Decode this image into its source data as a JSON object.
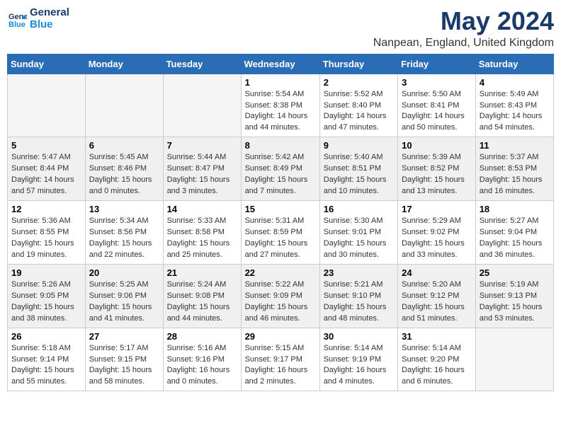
{
  "header": {
    "logo_line1": "General",
    "logo_line2": "Blue",
    "month_year": "May 2024",
    "location": "Nanpean, England, United Kingdom"
  },
  "days_of_week": [
    "Sunday",
    "Monday",
    "Tuesday",
    "Wednesday",
    "Thursday",
    "Friday",
    "Saturday"
  ],
  "weeks": [
    [
      {
        "day": "",
        "info": ""
      },
      {
        "day": "",
        "info": ""
      },
      {
        "day": "",
        "info": ""
      },
      {
        "day": "1",
        "info": "Sunrise: 5:54 AM\nSunset: 8:38 PM\nDaylight: 14 hours\nand 44 minutes."
      },
      {
        "day": "2",
        "info": "Sunrise: 5:52 AM\nSunset: 8:40 PM\nDaylight: 14 hours\nand 47 minutes."
      },
      {
        "day": "3",
        "info": "Sunrise: 5:50 AM\nSunset: 8:41 PM\nDaylight: 14 hours\nand 50 minutes."
      },
      {
        "day": "4",
        "info": "Sunrise: 5:49 AM\nSunset: 8:43 PM\nDaylight: 14 hours\nand 54 minutes."
      }
    ],
    [
      {
        "day": "5",
        "info": "Sunrise: 5:47 AM\nSunset: 8:44 PM\nDaylight: 14 hours\nand 57 minutes."
      },
      {
        "day": "6",
        "info": "Sunrise: 5:45 AM\nSunset: 8:46 PM\nDaylight: 15 hours\nand 0 minutes."
      },
      {
        "day": "7",
        "info": "Sunrise: 5:44 AM\nSunset: 8:47 PM\nDaylight: 15 hours\nand 3 minutes."
      },
      {
        "day": "8",
        "info": "Sunrise: 5:42 AM\nSunset: 8:49 PM\nDaylight: 15 hours\nand 7 minutes."
      },
      {
        "day": "9",
        "info": "Sunrise: 5:40 AM\nSunset: 8:51 PM\nDaylight: 15 hours\nand 10 minutes."
      },
      {
        "day": "10",
        "info": "Sunrise: 5:39 AM\nSunset: 8:52 PM\nDaylight: 15 hours\nand 13 minutes."
      },
      {
        "day": "11",
        "info": "Sunrise: 5:37 AM\nSunset: 8:53 PM\nDaylight: 15 hours\nand 16 minutes."
      }
    ],
    [
      {
        "day": "12",
        "info": "Sunrise: 5:36 AM\nSunset: 8:55 PM\nDaylight: 15 hours\nand 19 minutes."
      },
      {
        "day": "13",
        "info": "Sunrise: 5:34 AM\nSunset: 8:56 PM\nDaylight: 15 hours\nand 22 minutes."
      },
      {
        "day": "14",
        "info": "Sunrise: 5:33 AM\nSunset: 8:58 PM\nDaylight: 15 hours\nand 25 minutes."
      },
      {
        "day": "15",
        "info": "Sunrise: 5:31 AM\nSunset: 8:59 PM\nDaylight: 15 hours\nand 27 minutes."
      },
      {
        "day": "16",
        "info": "Sunrise: 5:30 AM\nSunset: 9:01 PM\nDaylight: 15 hours\nand 30 minutes."
      },
      {
        "day": "17",
        "info": "Sunrise: 5:29 AM\nSunset: 9:02 PM\nDaylight: 15 hours\nand 33 minutes."
      },
      {
        "day": "18",
        "info": "Sunrise: 5:27 AM\nSunset: 9:04 PM\nDaylight: 15 hours\nand 36 minutes."
      }
    ],
    [
      {
        "day": "19",
        "info": "Sunrise: 5:26 AM\nSunset: 9:05 PM\nDaylight: 15 hours\nand 38 minutes."
      },
      {
        "day": "20",
        "info": "Sunrise: 5:25 AM\nSunset: 9:06 PM\nDaylight: 15 hours\nand 41 minutes."
      },
      {
        "day": "21",
        "info": "Sunrise: 5:24 AM\nSunset: 9:08 PM\nDaylight: 15 hours\nand 44 minutes."
      },
      {
        "day": "22",
        "info": "Sunrise: 5:22 AM\nSunset: 9:09 PM\nDaylight: 15 hours\nand 46 minutes."
      },
      {
        "day": "23",
        "info": "Sunrise: 5:21 AM\nSunset: 9:10 PM\nDaylight: 15 hours\nand 48 minutes."
      },
      {
        "day": "24",
        "info": "Sunrise: 5:20 AM\nSunset: 9:12 PM\nDaylight: 15 hours\nand 51 minutes."
      },
      {
        "day": "25",
        "info": "Sunrise: 5:19 AM\nSunset: 9:13 PM\nDaylight: 15 hours\nand 53 minutes."
      }
    ],
    [
      {
        "day": "26",
        "info": "Sunrise: 5:18 AM\nSunset: 9:14 PM\nDaylight: 15 hours\nand 55 minutes."
      },
      {
        "day": "27",
        "info": "Sunrise: 5:17 AM\nSunset: 9:15 PM\nDaylight: 15 hours\nand 58 minutes."
      },
      {
        "day": "28",
        "info": "Sunrise: 5:16 AM\nSunset: 9:16 PM\nDaylight: 16 hours\nand 0 minutes."
      },
      {
        "day": "29",
        "info": "Sunrise: 5:15 AM\nSunset: 9:17 PM\nDaylight: 16 hours\nand 2 minutes."
      },
      {
        "day": "30",
        "info": "Sunrise: 5:14 AM\nSunset: 9:19 PM\nDaylight: 16 hours\nand 4 minutes."
      },
      {
        "day": "31",
        "info": "Sunrise: 5:14 AM\nSunset: 9:20 PM\nDaylight: 16 hours\nand 6 minutes."
      },
      {
        "day": "",
        "info": ""
      }
    ]
  ]
}
